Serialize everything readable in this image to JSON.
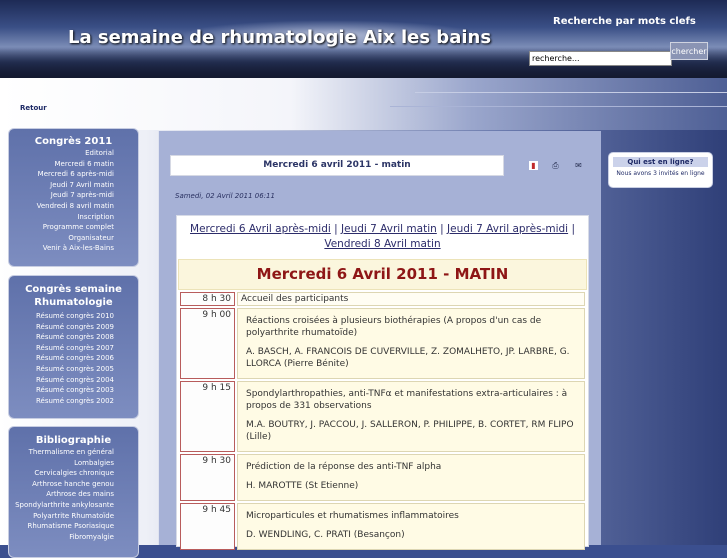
{
  "header": {
    "site_title": "La semaine de rhumatologie Aix les bains",
    "search_label": "Recherche par mots clefs",
    "search_value": "recherche...",
    "search_button": "chercher"
  },
  "back_link": "Retour",
  "sidebar": {
    "congres": {
      "title": "Congrès 2011",
      "items": [
        "Editorial",
        "Mercredi 6 matin",
        "Mercredi 6 après-midi",
        "Jeudi 7 Avril matin",
        "Jeudi 7 après-midi",
        "Vendredi 8 avril matin",
        "Inscription",
        "Programme complet",
        "Organisateur",
        "Venir à Aix-les-Bains"
      ]
    },
    "semaine": {
      "title": "Congrès semaine Rhumatologie",
      "items": [
        "Résumé congrès 2010",
        "Résumé congrès 2009",
        "Résumé congrès 2008",
        "Résumé congrès 2007",
        "Résumé congrès 2006",
        "Résumé congrès 2005",
        "Résumé congrès 2004",
        "Résumé congrès 2003",
        "Résumé congrès 2002"
      ]
    },
    "biblio": {
      "title": "Bibliographie",
      "items": [
        "Thermalisme en général",
        "Lombalgies",
        "Cervicalgies chronique",
        "Arthrose hanche genou",
        "Arthrose des mains",
        "Spondylarthrite ankylosante",
        "Polyartrite Rhumatoïde",
        "Rhumatisme Psoriasique",
        "Fibromyalgie"
      ]
    }
  },
  "article": {
    "title": "Mercredi 6 avril 2011 - matin",
    "icons": [
      "pdf-icon",
      "print-icon",
      "email-icon"
    ],
    "date": "Samedi, 02 Avril 2011 06:11",
    "nav_links": [
      "Mercredi 6 Avril après-midi",
      "Jeudi 7 Avril matin",
      "Jeudi 7 Avril après-midi",
      "Vendredi 8 Avril matin"
    ],
    "nav_separator": "|",
    "day_title": "Mercredi 6 Avril 2011 - MATIN",
    "sessions": [
      {
        "time": "8 h 30",
        "title": "Accueil des participants",
        "authors": ""
      },
      {
        "time": "9 h 00",
        "title": "Réactions croisées à plusieurs biothérapies (A propos d'un cas de polyarthrite rhumatoïde)",
        "authors": "A. BASCH, A. FRANCOIS DE CUVERVILLE, Z. ZOMALHETO, JP. LARBRE, G. LLORCA (Pierre Bénite)"
      },
      {
        "time": "9 h 15",
        "title": "Spondylarthropathies, anti-TNFα et manifestations extra-articulaires : à propos de 331 observations",
        "authors": "M.A. BOUTRY, J. PACCOU, J. SALLERON, P. PHILIPPE, B. CORTET, RM FLIPO (Lille)"
      },
      {
        "time": "9 h 30",
        "title": "Prédiction de la réponse des anti-TNF alpha",
        "authors": "H. MAROTTE (St Etienne)"
      },
      {
        "time": "9 h 45",
        "title": "Microparticules et rhumatismes inflammatoires",
        "authors": "D. WENDLING, C. PRATI (Besançon)"
      }
    ]
  },
  "online": {
    "title": "Qui est en ligne?",
    "text": "Nous avons 3 invités en ligne"
  },
  "colors": {
    "accent": "#8e1616",
    "panel": "#a6b1d6",
    "sidebox": "#6d7fb6"
  }
}
